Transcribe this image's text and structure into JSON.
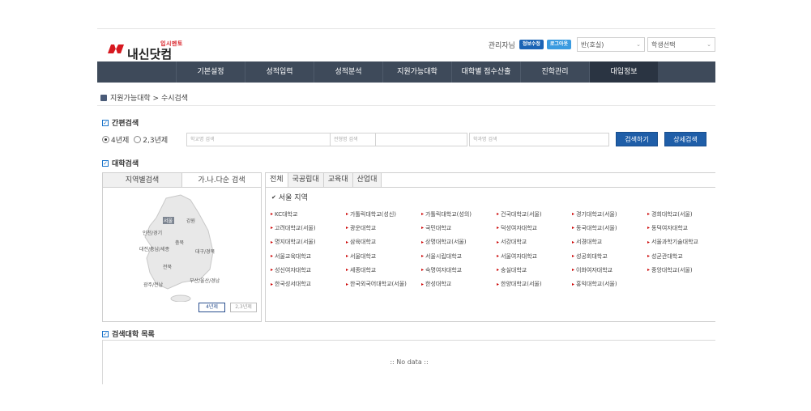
{
  "brand": {
    "sub": "입시멘토",
    "name": "내신닷컴",
    "color": "#d71920"
  },
  "header": {
    "admin_label": "관리자님",
    "edit_info_label": "정보수정",
    "logout_label": "로그아웃",
    "class_select": "반(호실)",
    "student_select": "학생선택"
  },
  "nav": {
    "items": [
      {
        "label": "기본설정"
      },
      {
        "label": "성적입력"
      },
      {
        "label": "성적분석"
      },
      {
        "label": "지원가능대학"
      },
      {
        "label": "대학별 점수산출"
      },
      {
        "label": "진학관리"
      },
      {
        "label": "대입정보"
      }
    ],
    "active_index": 6
  },
  "breadcrumb": "지원가능대학 > 수시검색",
  "quick_search": {
    "title": "간편검색",
    "radio_4yr": "4년제",
    "radio_23yr": "2,3년제",
    "school_placeholder": "학교명 검색",
    "type_placeholder": "전형명 검색",
    "dept_placeholder": "학과명 검색",
    "search_button": "검색하기",
    "detail_button": "상세검색"
  },
  "uni_search": {
    "title": "대학검색",
    "map_tab_region": "지역별검색",
    "map_tab_abc": "가.나.다순 검색",
    "map_regions": {
      "seoul": "서울",
      "gangwon": "강원",
      "incheon": "인천/경기",
      "chungbuk": "충북",
      "daejeon": "대전/충남/세종",
      "daegu": "대구/경북",
      "jeonbuk": "전북",
      "busan": "부산/울산/경남",
      "gwangju": "광주/전남",
      "jeju": "제주"
    },
    "btn_4yr": "4년제",
    "btn_23yr": "2,3년제",
    "tabs": [
      "전체",
      "국공립대",
      "교육대",
      "산업대"
    ],
    "region_label": "서울 지역",
    "universities": [
      "KC대학교",
      "가톨릭대학교(성신)",
      "가톨릭대학교(성의)",
      "건국대학교(서울)",
      "경기대학교(서울)",
      "경희대학교(서울)",
      "고려대학교(서울)",
      "광운대학교",
      "국민대학교",
      "덕성여자대학교",
      "동국대학교(서울)",
      "동덕여자대학교",
      "명지대학교(서울)",
      "삼육대학교",
      "상명대학교(서울)",
      "서강대학교",
      "서경대학교",
      "서울과학기술대학교",
      "서울교육대학교",
      "서울대학교",
      "서울시립대학교",
      "서울여자대학교",
      "성공회대학교",
      "성균관대학교",
      "성신여자대학교",
      "세종대학교",
      "숙명여자대학교",
      "숭실대학교",
      "이화여자대학교",
      "중앙대학교(서울)",
      "한국성서대학교",
      "한국외국어대학교(서울)",
      "한성대학교",
      "한양대학교(서울)",
      "홍익대학교(서울)"
    ]
  },
  "result": {
    "title": "검색대학 목록",
    "empty": ":: No data ::"
  },
  "colors": {
    "nav_bg": "#3e4a5a",
    "nav_active": "#2a3442",
    "button": "#1f5ea8",
    "accent_red": "#d71920",
    "map_fill": "#e6e6e6"
  }
}
